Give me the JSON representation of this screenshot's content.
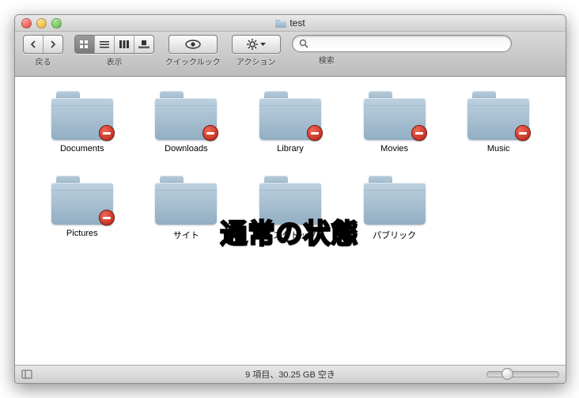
{
  "window": {
    "title": "test"
  },
  "toolbar": {
    "back_label": "戻る",
    "view_label": "表示",
    "quicklook_label": "クイックルック",
    "action_label": "アクション",
    "search_label": "検索",
    "search_placeholder": ""
  },
  "view_modes": {
    "active": "icon"
  },
  "folders": [
    {
      "name": "Documents",
      "restricted": true
    },
    {
      "name": "Downloads",
      "restricted": true
    },
    {
      "name": "Library",
      "restricted": true
    },
    {
      "name": "Movies",
      "restricted": true
    },
    {
      "name": "Music",
      "restricted": true
    },
    {
      "name": "Pictures",
      "restricted": true
    },
    {
      "name": "サイト",
      "restricted": false
    },
    {
      "name": "デスクトップ",
      "restricted": false
    },
    {
      "name": "パブリック",
      "restricted": false
    }
  ],
  "status": {
    "text": "9 項目、30.25 GB 空き"
  },
  "overlay_caption": "通常の状態"
}
